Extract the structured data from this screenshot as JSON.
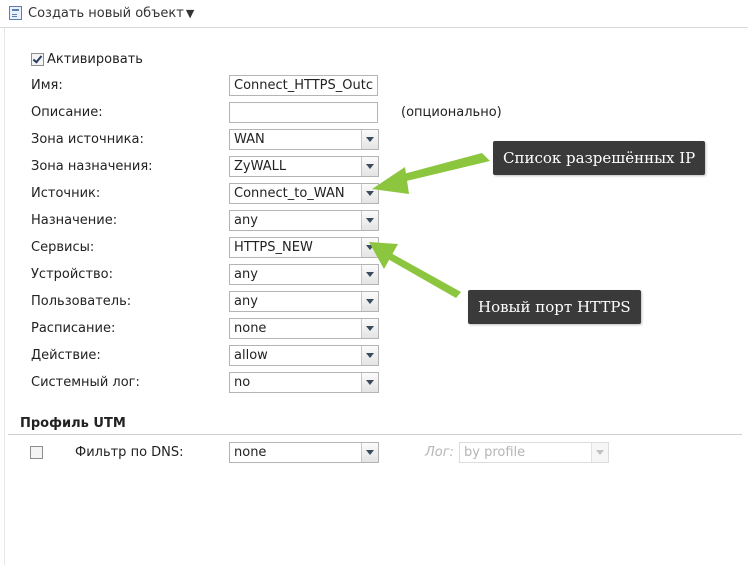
{
  "toolbar": {
    "create_label": "Создать новый объект",
    "create_caret": "▼"
  },
  "form": {
    "activate_label": "Активировать",
    "activate_checked": true,
    "name": {
      "label": "Имя:",
      "value": "Connect_HTTPS_Outc"
    },
    "description": {
      "label": "Описание:",
      "value": "",
      "hint": "(опционально)"
    },
    "source_zone": {
      "label": "Зона источника:",
      "value": "WAN"
    },
    "dest_zone": {
      "label": "Зона назначения:",
      "value": "ZyWALL"
    },
    "source": {
      "label": "Источник:",
      "value": "Connect_to_WAN"
    },
    "destination": {
      "label": "Назначение:",
      "value": "any"
    },
    "services": {
      "label": "Сервисы:",
      "value": "HTTPS_NEW"
    },
    "device": {
      "label": "Устройство:",
      "value": "any"
    },
    "user": {
      "label": "Пользователь:",
      "value": "any"
    },
    "schedule": {
      "label": "Расписание:",
      "value": "none"
    },
    "action": {
      "label": "Действие:",
      "value": "allow"
    },
    "syslog": {
      "label": "Системный лог:",
      "value": "no"
    }
  },
  "utm": {
    "title": "Профиль UTM",
    "dns_filter": {
      "checked": false,
      "label": "Фильтр по DNS:",
      "value": "none",
      "log_label": "Лог:",
      "log_value": "by profile"
    }
  },
  "annotations": {
    "ip_list": "Список разрешённых IP",
    "new_https_port": "Новый порт HTTPS",
    "arrow_color": "#8cc63f",
    "box_color": "#3a3a3a"
  }
}
